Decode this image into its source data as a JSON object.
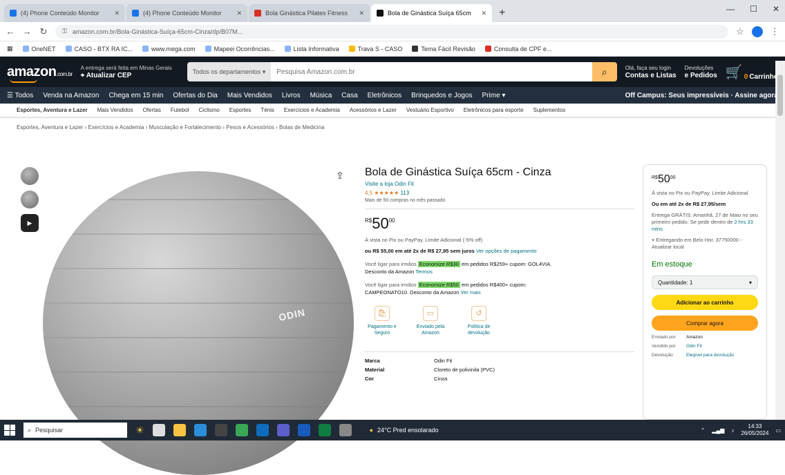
{
  "browser": {
    "tabs": [
      {
        "title": "(4) Phone Conteúdo Monitor",
        "color": "#1a73e8",
        "active": false
      },
      {
        "title": "(4) Phone Conteúdo Monitor",
        "color": "#1a73e8",
        "active": false
      },
      {
        "title": "Bola Ginástica Pilates Fitness",
        "color": "#d93025",
        "active": false
      },
      {
        "title": "Bola de Ginástica Suíça 65cm",
        "color": "#111111",
        "active": true
      }
    ],
    "new_tab": "+",
    "url": "amazon.com.br/Bola-Ginástica-Suíça-65cm-Cinza/dp/B07M...",
    "bookmarks": [
      "OneNET",
      "CASO - BTX RA IC...",
      "www.mega.com",
      "Mapeei Ocorrências...",
      "Lista Informativa",
      "Trava S - CASO",
      "Tema Fácil Revisão",
      "Consulta de CPF e..."
    ]
  },
  "amazon": {
    "logo": "amazon",
    "logo_suffix": ".com.br",
    "deliver_line1": "A entrega será feita em Minas Gerais",
    "deliver_line2": "Atualizar CEP",
    "search_category": "Todos os departamentos",
    "search_placeholder": "Pesquisa Amazon.com.br",
    "account_line1": "Olá, faça seu login",
    "account_line2": "Contas e Listas",
    "orders_line1": "Devoluções",
    "orders_line2": "e Pedidos",
    "cart_label": "Carrinho",
    "cart_count": "0",
    "nav": [
      "☰ Todos",
      "Venda na Amazon",
      "Chega em 15 min",
      "Ofertas do Dia",
      "Mais Vendidos",
      "Livros",
      "Música",
      "Casa",
      "Eletrônicos",
      "Brinquedos e Jogos",
      "Prime ▾"
    ],
    "nav_right": "Off Campus: Seus impressíveis · Assine agora",
    "subnav": [
      "Esportes, Aventura e Lazer",
      "Mais Vendidos",
      "Ofertas",
      "Futebol",
      "Ciclismo",
      "Esportes",
      "Ténis",
      "Exercícios e Academia",
      "Acessórios e Lazer",
      "Vestuário Esportivo",
      "Eletrônicos para esporte",
      "Suplementos"
    ],
    "breadcrumb": "Esportes, Aventura e Lazer › Exercícios e Academia › Musculação e Fortalecimento › Pesos e Acessórios › Bolas de Medicina"
  },
  "product": {
    "title": "Bola de Ginástica Suíça 65cm - Cinza",
    "store": "Visite a loja Odin Fit",
    "rating": "4,5 ★★★★★",
    "rating_count": "113",
    "bought": "Mais de 50 compras no mês passado",
    "price_symbol": "R$",
    "price_whole": "50",
    "price_cents": "00",
    "pix_line": "À vista no Pix ou PayPay. Limite Adicional (-5% off)",
    "installments": "ou R$ 55,00 em até 2x de R$ 27,95 sem juros",
    "installments_link": "Ver opções de pagamento",
    "coupon1_prefix": "Você ligar para irmãos",
    "coupon1_badge": "Economize R$30",
    "coupon1_text": "em pedidos R$259+ cupom: GOL4VIA.",
    "coupon1_sub": "Desconto da Amazon",
    "coupon1_link": "Termos",
    "coupon2_prefix": "Você ligar para irmãos",
    "coupon2_badge": "Economize R$50",
    "coupon2_text": "em pedidos R$400+ cupom:",
    "coupon2_sub": "CAMPEONATO10. Desconto da Amazon",
    "coupon2_link": "Ver mais",
    "features": [
      {
        "icon": "🛍",
        "label": "Pagamento e Seguro"
      },
      {
        "icon": "▭",
        "label": "Enviado pela Amazon"
      },
      {
        "icon": "↺",
        "label": "Política de devolução"
      }
    ],
    "specs": [
      {
        "k": "Marca",
        "v": "Odin Fit"
      },
      {
        "k": "Material",
        "v": "Cloreto de polivinila (PVC)"
      },
      {
        "k": "Cor",
        "v": "Cinza"
      }
    ],
    "ball_brand": "ODIN",
    "thumb_video_label": "▶"
  },
  "buybox": {
    "price_symbol": "R$",
    "price_whole": "50",
    "price_cents": "00",
    "pix": "À vista no Pix ou PayPay. Limite Adicional",
    "installments": "Ou em até 2x de R$ 27,95/sem",
    "delivery": "Entrega GRÁTIS: Amanhã, 27 de Maio no seu primeiro pedido. Se pedir dentro de",
    "delivery_link": "2 hrs 33 mins",
    "location": "Entregando em Belo Hor. 37750000 - Atualizar local",
    "stock": "Em estoque",
    "qty": "Quantidade: 1",
    "add_cart": "Adicionar ao carrinho",
    "buy_now": "Comprar agora",
    "rows": [
      {
        "k": "Enviado por",
        "v": "Amazon"
      },
      {
        "k": "Vendido por",
        "v": "Odin Fit"
      },
      {
        "k": "Devolução",
        "v": "Elegível para devolução"
      }
    ]
  },
  "taskbar": {
    "search": "Pesquisar",
    "weather": "24°C Pred ensolarado",
    "time": "14:33",
    "date": "26/05/2024"
  }
}
